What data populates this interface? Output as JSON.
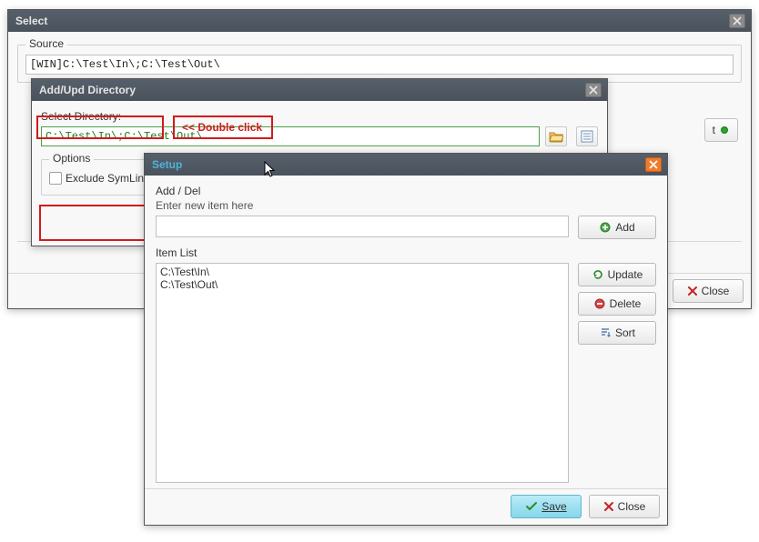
{
  "selectWindow": {
    "title": "Select",
    "source": {
      "legend": "Source",
      "value": "[WIN]C:\\Test\\In\\;C:\\Test\\Out\\"
    },
    "start": {
      "label": "t"
    },
    "footer": {
      "close": "Close"
    }
  },
  "dirWindow": {
    "title": "Add/Upd Directory",
    "selectDirLabel": "Select Directory:",
    "selectDirValue": "C:\\Test\\In\\;C:\\Test\\Out\\",
    "doubleClick": "<< Double click",
    "options": {
      "legend": "Options",
      "excludeSymLink": "Exclude SymLink"
    }
  },
  "setupWindow": {
    "title": "Setup",
    "addDel": {
      "legend": "Add / Del",
      "placeholder": "Enter new item here",
      "value": ""
    },
    "itemList": {
      "legend": "Item List",
      "items": [
        "C:\\Test\\In\\",
        "C:\\Test\\Out\\"
      ]
    },
    "buttons": {
      "add": "Add",
      "update": "Update",
      "delete": "Delete",
      "sort": "Sort",
      "save": "Save",
      "close": "Close"
    }
  }
}
